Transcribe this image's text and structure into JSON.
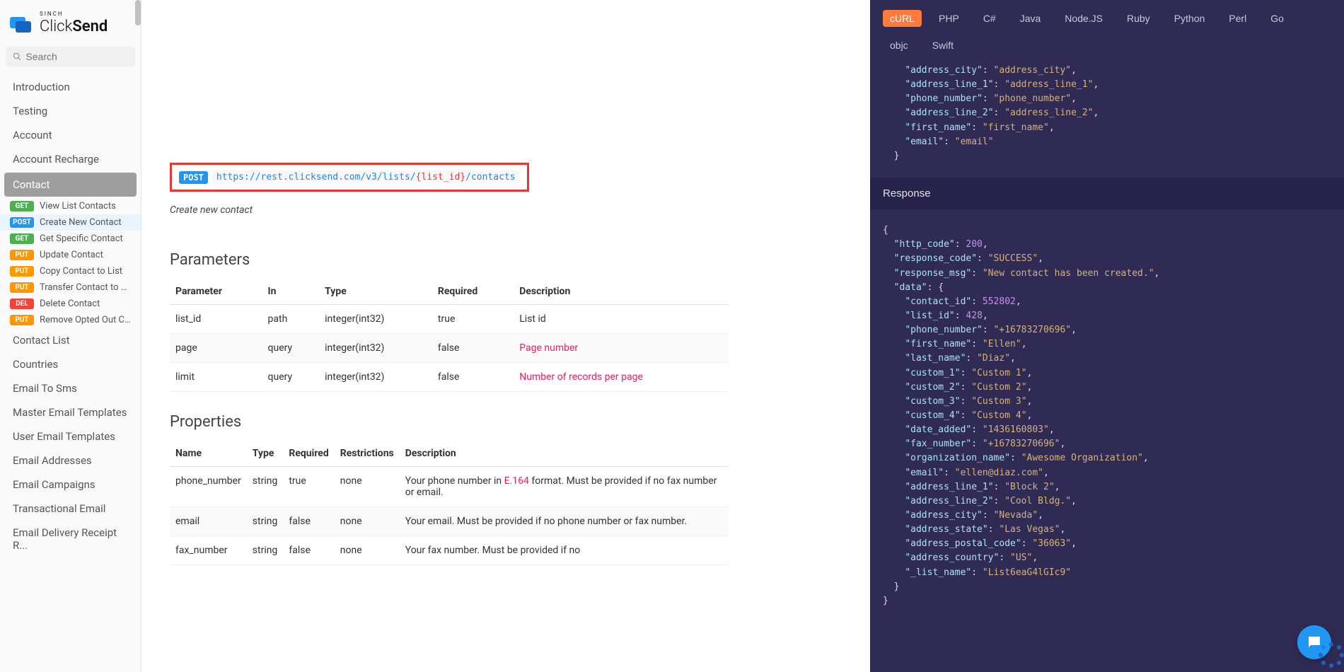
{
  "brand": {
    "superscript": "SINCH",
    "name": "ClickSend"
  },
  "search": {
    "placeholder": "Search"
  },
  "nav": {
    "top": [
      "Introduction",
      "Testing",
      "Account",
      "Account Recharge"
    ],
    "activeCategory": "Contact",
    "sub": [
      {
        "method": "GET",
        "label": "View List Contacts"
      },
      {
        "method": "POST",
        "label": "Create New Contact",
        "selected": true
      },
      {
        "method": "GET",
        "label": "Get Specific Contact"
      },
      {
        "method": "PUT",
        "label": "Update Contact"
      },
      {
        "method": "PUT",
        "label": "Copy Contact to List"
      },
      {
        "method": "PUT",
        "label": "Transfer Contact to List"
      },
      {
        "method": "DEL",
        "label": "Delete Contact"
      },
      {
        "method": "PUT",
        "label": "Remove Opted Out Cont..."
      }
    ],
    "below": [
      "Contact List",
      "Countries",
      "Email To Sms",
      "Master Email Templates",
      "User Email Templates",
      "Email Addresses",
      "Email Campaigns",
      "Transactional Email",
      "Email Delivery Receipt R..."
    ]
  },
  "endpoint": {
    "method": "POST",
    "base": "https://rest.clicksend.com/v3/lists/",
    "param": "{list_id}",
    "suffix": "/contacts",
    "description": "Create new contact"
  },
  "sections": {
    "parameters": "Parameters",
    "properties": "Properties"
  },
  "paramTable": {
    "headers": [
      "Parameter",
      "In",
      "Type",
      "Required",
      "Description"
    ],
    "rows": [
      {
        "c0": "list_id",
        "c1": "path",
        "c2": "integer(int32)",
        "c3": "true",
        "c4": "List id",
        "link": false
      },
      {
        "c0": "page",
        "c1": "query",
        "c2": "integer(int32)",
        "c3": "false",
        "c4": "Page number",
        "link": true
      },
      {
        "c0": "limit",
        "c1": "query",
        "c2": "integer(int32)",
        "c3": "false",
        "c4": "Number of records per page",
        "link": true
      }
    ]
  },
  "propTable": {
    "headers": [
      "Name",
      "Type",
      "Required",
      "Restrictions",
      "Description"
    ],
    "rows": [
      {
        "c0": "phone_number",
        "c1": "string",
        "c2": "true",
        "c3": "none",
        "c4_pre": "Your phone number in ",
        "c4_link": "E.164",
        "c4_post": " format. Must be provided if no fax number or email."
      },
      {
        "c0": "email",
        "c1": "string",
        "c2": "false",
        "c3": "none",
        "c4": "Your email. Must be provided if no phone number or fax number."
      },
      {
        "c0": "fax_number",
        "c1": "string",
        "c2": "false",
        "c3": "none",
        "c4": "Your fax number. Must be provided if no"
      }
    ]
  },
  "codePanel": {
    "langs": [
      "cURL",
      "PHP",
      "C#",
      "Java",
      "Node.JS",
      "Ruby",
      "Python",
      "Perl",
      "Go",
      "objc",
      "Swift"
    ],
    "activeLang": "cURL",
    "requestTail": [
      [
        "k",
        "\"address_city\"",
        "p",
        ": ",
        "s",
        "\"address_city\"",
        "p",
        ","
      ],
      [
        "k",
        "\"address_line_1\"",
        "p",
        ": ",
        "s",
        "\"address_line_1\"",
        "p",
        ","
      ],
      [
        "k",
        "\"phone_number\"",
        "p",
        ": ",
        "s",
        "\"phone_number\"",
        "p",
        ","
      ],
      [
        "k",
        "\"address_line_2\"",
        "p",
        ": ",
        "s",
        "\"address_line_2\"",
        "p",
        ","
      ],
      [
        "k",
        "\"first_name\"",
        "p",
        ": ",
        "s",
        "\"first_name\"",
        "p",
        ","
      ],
      [
        "k",
        "\"email\"",
        "p",
        ": ",
        "s",
        "\"email\""
      ]
    ],
    "responseTitle": "Response",
    "response": {
      "http_code": 200,
      "response_code": "SUCCESS",
      "response_msg": "New contact has been created.",
      "data": {
        "contact_id": 552802,
        "list_id": 428,
        "phone_number": "+16783270696",
        "first_name": "Ellen",
        "last_name": "Diaz",
        "custom_1": "Custom 1",
        "custom_2": "Custom 2",
        "custom_3": "Custom 3",
        "custom_4": "Custom 4",
        "date_added": "1436160803",
        "fax_number": "+16783270696",
        "organization_name": "Awesome Organization",
        "email": "ellen@diaz.com",
        "address_line_1": "Block 2",
        "address_line_2": "Cool Bldg.",
        "address_city": "Nevada",
        "address_state": "Las Vegas",
        "address_postal_code": "36063",
        "address_country": "US",
        "_list_name": "List6eaG4lGIc9"
      }
    }
  }
}
